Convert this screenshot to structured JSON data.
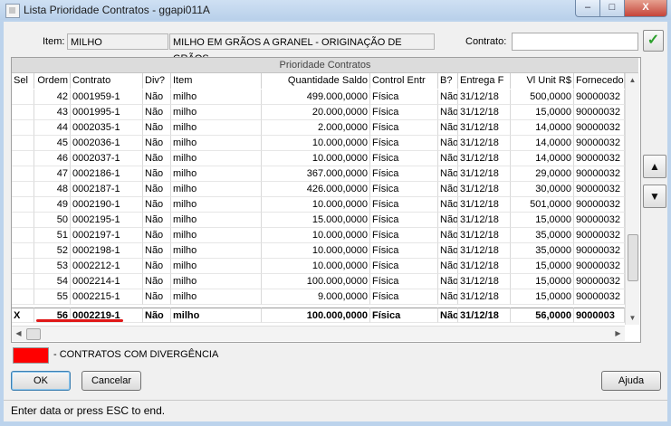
{
  "window": {
    "title": "Lista Prioridade Contratos - ggapi011A",
    "minimize": "–",
    "maximize": "□",
    "close": "X"
  },
  "filters": {
    "item_label": "Item:",
    "item_code": "MILHO",
    "item_desc": "MILHO EM GRÃOS A GRANEL - ORIGINAÇÃO DE GRÃOS",
    "contrato_label": "Contrato:",
    "contrato_value": "",
    "confirm_icon": "✓"
  },
  "grid": {
    "title": "Prioridade Contratos",
    "columns": [
      "Sel",
      "Ordem",
      "Contrato",
      "Div?",
      "Item",
      "Quantidade Saldo",
      "Control Entr",
      "B?",
      "Entrega F",
      "Vl Unit R$",
      "Fornecedo"
    ],
    "rows": [
      [
        "",
        "42",
        "0001959-1",
        "Não",
        "milho",
        "499.000,0000",
        "Física",
        "Não",
        "31/12/18",
        "500,0000",
        "90000032"
      ],
      [
        "",
        "43",
        "0001995-1",
        "Não",
        "milho",
        "20.000,0000",
        "Física",
        "Não",
        "31/12/18",
        "15,0000",
        "90000032"
      ],
      [
        "",
        "44",
        "0002035-1",
        "Não",
        "milho",
        "2.000,0000",
        "Física",
        "Não",
        "31/12/18",
        "14,0000",
        "90000032"
      ],
      [
        "",
        "45",
        "0002036-1",
        "Não",
        "milho",
        "10.000,0000",
        "Física",
        "Não",
        "31/12/18",
        "14,0000",
        "90000032"
      ],
      [
        "",
        "46",
        "0002037-1",
        "Não",
        "milho",
        "10.000,0000",
        "Física",
        "Não",
        "31/12/18",
        "14,0000",
        "90000032"
      ],
      [
        "",
        "47",
        "0002186-1",
        "Não",
        "milho",
        "367.000,0000",
        "Física",
        "Não",
        "31/12/18",
        "29,0000",
        "90000032"
      ],
      [
        "",
        "48",
        "0002187-1",
        "Não",
        "milho",
        "426.000,0000",
        "Física",
        "Não",
        "31/12/18",
        "30,0000",
        "90000032"
      ],
      [
        "",
        "49",
        "0002190-1",
        "Não",
        "milho",
        "10.000,0000",
        "Física",
        "Não",
        "31/12/18",
        "501,0000",
        "90000032"
      ],
      [
        "",
        "50",
        "0002195-1",
        "Não",
        "milho",
        "15.000,0000",
        "Física",
        "Não",
        "31/12/18",
        "15,0000",
        "90000032"
      ],
      [
        "",
        "51",
        "0002197-1",
        "Não",
        "milho",
        "10.000,0000",
        "Física",
        "Não",
        "31/12/18",
        "35,0000",
        "90000032"
      ],
      [
        "",
        "52",
        "0002198-1",
        "Não",
        "milho",
        "10.000,0000",
        "Física",
        "Não",
        "31/12/18",
        "35,0000",
        "90000032"
      ],
      [
        "",
        "53",
        "0002212-1",
        "Não",
        "milho",
        "10.000,0000",
        "Física",
        "Não",
        "31/12/18",
        "15,0000",
        "90000032"
      ],
      [
        "",
        "54",
        "0002214-1",
        "Não",
        "milho",
        "100.000,0000",
        "Física",
        "Não",
        "31/12/18",
        "15,0000",
        "90000032"
      ],
      [
        "",
        "55",
        "0002215-1",
        "Não",
        "milho",
        "9.000,0000",
        "Física",
        "Não",
        "31/12/18",
        "15,0000",
        "90000032"
      ]
    ],
    "selected_row": [
      "X",
      "56",
      "0002219-1",
      "Não",
      "milho",
      "100.000,0000",
      "Física",
      "Não",
      "31/12/18",
      "56,0000",
      "9000003"
    ],
    "scroll_up": "▲",
    "scroll_down": "▼",
    "scroll_left": "◀",
    "scroll_right": "▶"
  },
  "side": {
    "up_arrow": "▲",
    "down_arrow": "▼"
  },
  "legend": {
    "text": "- CONTRATOS COM DIVERGÊNCIA",
    "color": "#ff0000"
  },
  "buttons": {
    "ok": "OK",
    "cancel": "Cancelar",
    "help": "Ajuda"
  },
  "status": {
    "text": "Enter data or press ESC to end."
  }
}
